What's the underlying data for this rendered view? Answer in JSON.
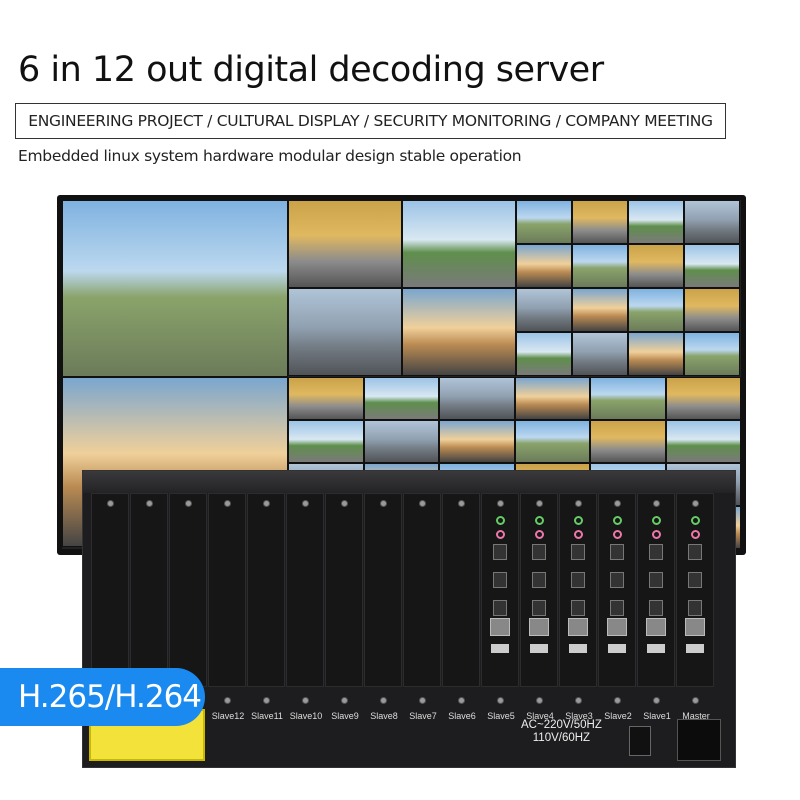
{
  "header": {
    "title": "6 in 12 out digital decoding server",
    "applications": "ENGINEERING PROJECT / CULTURAL DISPLAY / SECURITY MONITORING / COMPANY MEETING",
    "subtitle": "Embedded linux system hardware modular design stable operation"
  },
  "badge": {
    "label": "H.265/H.264",
    "color": "#1b8af0"
  },
  "chassis": {
    "slot_labels": [
      "Slave12",
      "Slave11",
      "Slave10",
      "Slave9",
      "Slave8",
      "Slave7",
      "Slave6",
      "Slave5",
      "Slave4",
      "Slave3",
      "Slave2",
      "Slave1",
      "Master"
    ],
    "power_line1": "AC~220V/50HZ",
    "power_line2": "110V/60HZ"
  }
}
